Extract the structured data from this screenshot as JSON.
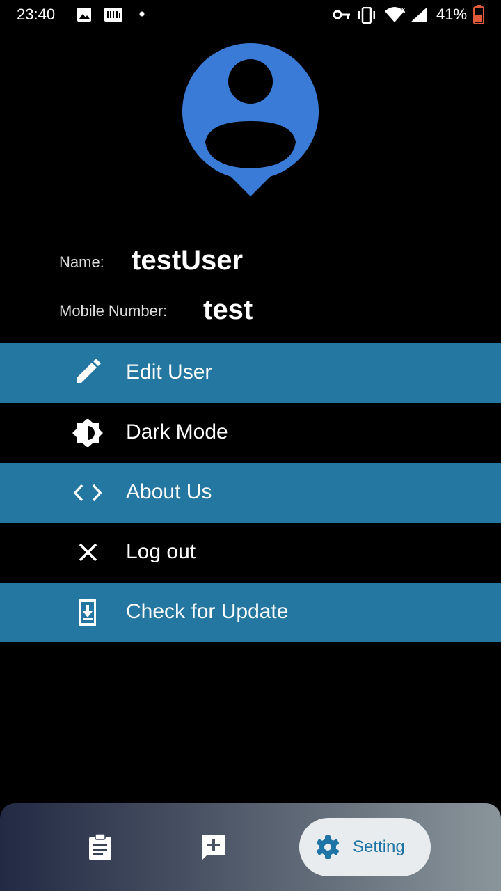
{
  "status_bar": {
    "time": "23:40",
    "battery_percent": "41%",
    "icons": [
      "image-icon",
      "imdb-icon",
      "dot-icon",
      "key-icon",
      "vibrate-icon",
      "wifi-icon",
      "signal-icon",
      "battery-icon"
    ]
  },
  "profile": {
    "avatar_icon": "user-pin-icon",
    "avatar_color": "#3b7bd8",
    "name_label": "Name:",
    "name_value": "testUser",
    "mobile_label": "Mobile Number:",
    "mobile_value": "test"
  },
  "menu": {
    "items": [
      {
        "label": "Edit User",
        "icon": "pencil-icon"
      },
      {
        "label": "Dark Mode",
        "icon": "brightness-icon"
      },
      {
        "label": "About Us",
        "icon": "code-icon"
      },
      {
        "label": "Log out",
        "icon": "close-icon"
      },
      {
        "label": "Check for Update",
        "icon": "phone-download-icon"
      }
    ],
    "accent_color": "#2477a1"
  },
  "bottom_nav": {
    "items": [
      {
        "icon": "clipboard-icon"
      },
      {
        "icon": "add-comment-icon"
      },
      {
        "icon": "gear-icon",
        "label": "Setting",
        "active": true
      }
    ]
  }
}
